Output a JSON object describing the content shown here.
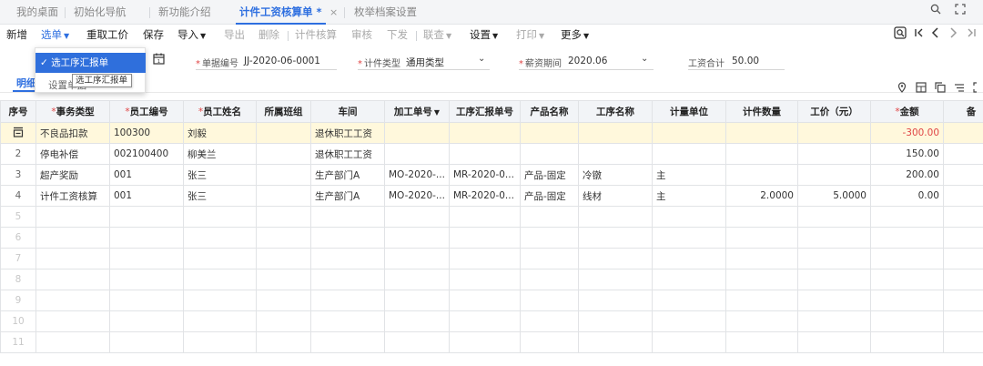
{
  "tabs": [
    {
      "label": "我的桌面"
    },
    {
      "label": "初始化导航"
    },
    {
      "label": "新功能介绍"
    },
    {
      "label": "计件工资核算单 *",
      "active": true
    },
    {
      "label": "枚举档案设置"
    }
  ],
  "tab_close": "×",
  "window_icons": {
    "search": "🔍",
    "expand": "⛶"
  },
  "toolbar": {
    "new": "新增",
    "select_bill": "选单",
    "refetch": "重取工价",
    "save": "保存",
    "import": "导入",
    "export": "导出",
    "delete": "删除",
    "calc": "计件核算",
    "audit": "审核",
    "issue": "下发",
    "link": "联查",
    "settings": "设置",
    "print": "打印",
    "more": "更多"
  },
  "nav_icons": {
    "locate": "⌕",
    "first": "|<",
    "prev": "<",
    "next": ">",
    "last": ">|"
  },
  "dropdown": {
    "item1": "✓ 选工序汇报单",
    "item2": "设置单据",
    "tooltip": "选工序汇报单"
  },
  "form": {
    "bill_no_label": "单据编号",
    "bill_no": "JJ-2020-06-0001",
    "piece_type_label": "计件类型",
    "piece_type": "通用类型",
    "period_label": "薪资期间",
    "period": "2020.06",
    "total_label": "工资合计",
    "total": "50.00",
    "calendar_icon": "📅"
  },
  "sub_tab": "明细",
  "grid_icons": [
    "◎",
    "⊞",
    "⧉",
    "≂",
    "⛶"
  ],
  "columns": [
    {
      "label": "序号",
      "req": false
    },
    {
      "label": "事务类型",
      "req": true
    },
    {
      "label": "员工编号",
      "req": true
    },
    {
      "label": "员工姓名",
      "req": true
    },
    {
      "label": "所属班组",
      "req": false
    },
    {
      "label": "车间",
      "req": false
    },
    {
      "label": "加工单号",
      "req": false,
      "sort": true
    },
    {
      "label": "工序汇报单号",
      "req": false
    },
    {
      "label": "产品名称",
      "req": false
    },
    {
      "label": "工序名称",
      "req": false
    },
    {
      "label": "计量单位",
      "req": false
    },
    {
      "label": "计件数量",
      "req": false
    },
    {
      "label": "工价（元）",
      "req": false
    },
    {
      "label": "金额",
      "req": true
    },
    {
      "label": "备",
      "req": false
    }
  ],
  "rows": [
    {
      "idx": "",
      "type": "不良品扣款",
      "emp_no": "100300",
      "name": "刘毅",
      "team": "",
      "workshop": "退休职工工资",
      "mo": "",
      "mr": "",
      "product": "",
      "process": "",
      "unit": "",
      "qty": "",
      "price": "",
      "amount": "-300.00",
      "note": "",
      "selected": true,
      "negative": true
    },
    {
      "idx": "2",
      "type": "停电补偿",
      "emp_no": "002100400",
      "name": "柳美兰",
      "team": "",
      "workshop": "退休职工工资",
      "mo": "",
      "mr": "",
      "product": "",
      "process": "",
      "unit": "",
      "qty": "",
      "price": "",
      "amount": "150.00",
      "note": ""
    },
    {
      "idx": "3",
      "type": "超产奖励",
      "emp_no": "001",
      "name": "张三",
      "team": "",
      "workshop": "生产部门A",
      "mo": "MO-2020-...",
      "mr": "MR-2020-0...",
      "product": "产品-固定",
      "process": "冷镦",
      "unit": "主",
      "qty": "",
      "price": "",
      "amount": "200.00",
      "note": ""
    },
    {
      "idx": "4",
      "type": "计件工资核算",
      "emp_no": "001",
      "name": "张三",
      "team": "",
      "workshop": "生产部门A",
      "mo": "MO-2020-...",
      "mr": "MR-2020-0...",
      "product": "产品-固定",
      "process": "线材",
      "unit": "主",
      "qty": "2.0000",
      "price": "5.0000",
      "amount": "0.00",
      "note": ""
    }
  ],
  "empty_rows": [
    "5",
    "6",
    "7",
    "8",
    "9",
    "10",
    "11"
  ],
  "row_edit_icon": "⊡"
}
